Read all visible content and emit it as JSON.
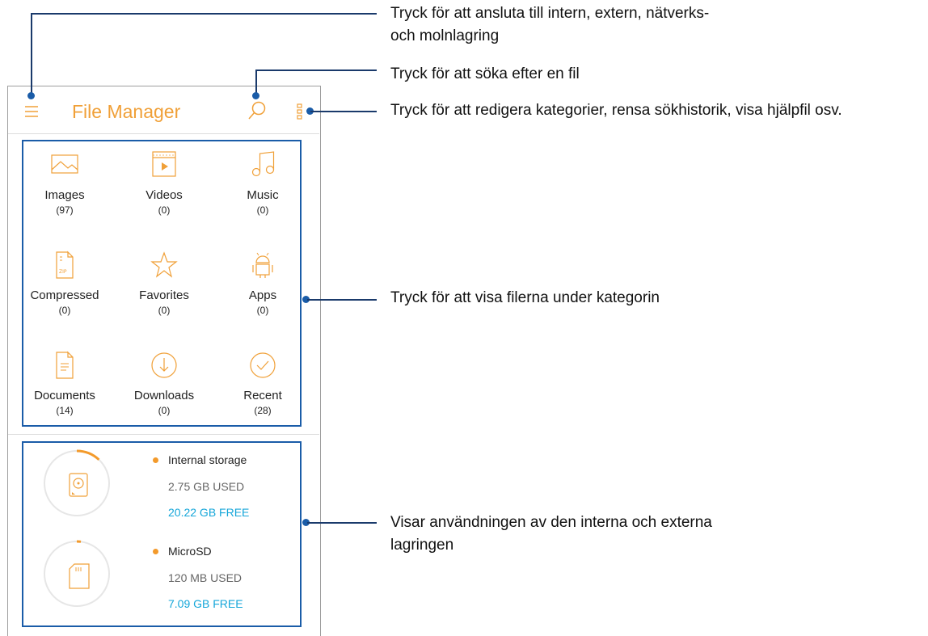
{
  "app": {
    "title": "File Manager",
    "menu_icon": "hamburger-menu-icon",
    "search_icon": "search-icon",
    "more_icon": "more-options-icon",
    "accent_color": "#f0a038"
  },
  "categories": [
    {
      "label": "Images",
      "count": "(97)",
      "icon": "image-icon"
    },
    {
      "label": "Videos",
      "count": "(0)",
      "icon": "video-icon"
    },
    {
      "label": "Music",
      "count": "(0)",
      "icon": "music-note-icon"
    },
    {
      "label": "Compressed",
      "count": "(0)",
      "icon": "zip-file-icon"
    },
    {
      "label": "Favorites",
      "count": "(0)",
      "icon": "star-icon"
    },
    {
      "label": "Apps",
      "count": "(0)",
      "icon": "android-icon"
    },
    {
      "label": "Documents",
      "count": "(14)",
      "icon": "document-icon"
    },
    {
      "label": "Downloads",
      "count": "(0)",
      "icon": "download-icon"
    },
    {
      "label": "Recent",
      "count": "(28)",
      "icon": "check-circle-icon"
    }
  ],
  "storage": [
    {
      "name": "Internal storage",
      "used": "2.75 GB USED",
      "free": "20.22 GB FREE",
      "icon": "hard-drive-icon",
      "used_fraction": 0.12
    },
    {
      "name": "MicroSD",
      "used": "120 MB USED",
      "free": "7.09 GB FREE",
      "icon": "sd-card-icon",
      "used_fraction": 0.02
    }
  ],
  "callouts": {
    "menu": "Tryck för att ansluta till intern, extern, nätverks-\noch molnlagring",
    "search": "Tryck för att söka efter en fil",
    "more": "Tryck för att redigera kategorier, rensa sökhistorik, visa hjälpfil osv.",
    "categories": "Tryck för att visa filerna under kategorin",
    "storage": "Visar användningen av den interna och externa\nlagringen"
  },
  "colors": {
    "highlight": "#1a5ca8",
    "free_text": "#14a6d9",
    "dot": "#f39a2b"
  }
}
